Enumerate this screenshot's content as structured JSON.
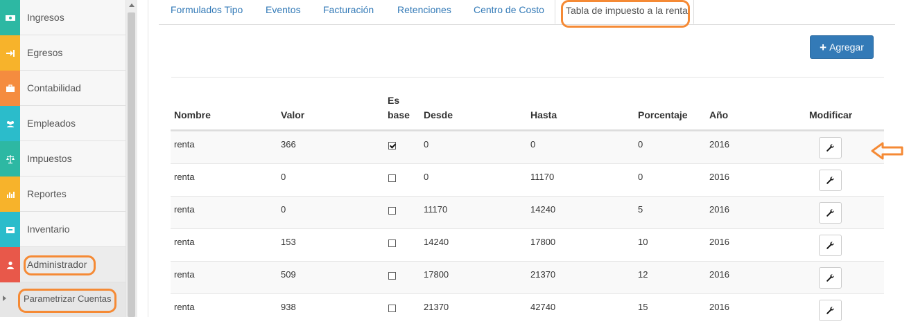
{
  "sidebar": {
    "items": [
      {
        "label": "Ingresos",
        "icon": "money-icon",
        "color": "#2db8a3"
      },
      {
        "label": "Egresos",
        "icon": "sign-in-icon",
        "color": "#f7b32b"
      },
      {
        "label": "Contabilidad",
        "icon": "briefcase-icon",
        "color": "#f58c3f"
      },
      {
        "label": "Empleados",
        "icon": "users-icon",
        "color": "#2bbccb"
      },
      {
        "label": "Impuestos",
        "icon": "balance-scale-icon",
        "color": "#2db8a3"
      },
      {
        "label": "Reportes",
        "icon": "bar-chart-icon",
        "color": "#f7b32b"
      },
      {
        "label": "Inventario",
        "icon": "inbox-icon",
        "color": "#2bbccb"
      },
      {
        "label": "Administrador",
        "icon": "user-icon",
        "color": "#e8584a"
      }
    ],
    "sub_item": {
      "label": "Parametrizar Cuentas"
    }
  },
  "tabs": [
    {
      "label": "Formulados Tipo"
    },
    {
      "label": "Eventos"
    },
    {
      "label": "Facturación"
    },
    {
      "label": "Retenciones"
    },
    {
      "label": "Centro de Costo"
    },
    {
      "label": "Tabla de impuesto a la renta"
    }
  ],
  "toolbar": {
    "add_label": "Agregar"
  },
  "table": {
    "headers": {
      "nombre": "Nombre",
      "valor": "Valor",
      "es_base_1": "Es",
      "es_base_2": "base",
      "desde": "Desde",
      "hasta": "Hasta",
      "porcentaje": "Porcentaje",
      "anio": "Año",
      "modificar": "Modificar"
    },
    "rows": [
      {
        "nombre": "renta",
        "valor": "366",
        "es_base": true,
        "desde": "0",
        "hasta": "0",
        "porcentaje": "0",
        "anio": "2016"
      },
      {
        "nombre": "renta",
        "valor": "0",
        "es_base": false,
        "desde": "0",
        "hasta": "11170",
        "porcentaje": "0",
        "anio": "2016"
      },
      {
        "nombre": "renta",
        "valor": "0",
        "es_base": false,
        "desde": "11170",
        "hasta": "14240",
        "porcentaje": "5",
        "anio": "2016"
      },
      {
        "nombre": "renta",
        "valor": "153",
        "es_base": false,
        "desde": "14240",
        "hasta": "17800",
        "porcentaje": "10",
        "anio": "2016"
      },
      {
        "nombre": "renta",
        "valor": "509",
        "es_base": false,
        "desde": "17800",
        "hasta": "21370",
        "porcentaje": "12",
        "anio": "2016"
      },
      {
        "nombre": "renta",
        "valor": "938",
        "es_base": false,
        "desde": "21370",
        "hasta": "42740",
        "porcentaje": "15",
        "anio": "2016"
      }
    ]
  },
  "colors": {
    "primary": "#337ab7",
    "annotation": "#f58a35"
  }
}
